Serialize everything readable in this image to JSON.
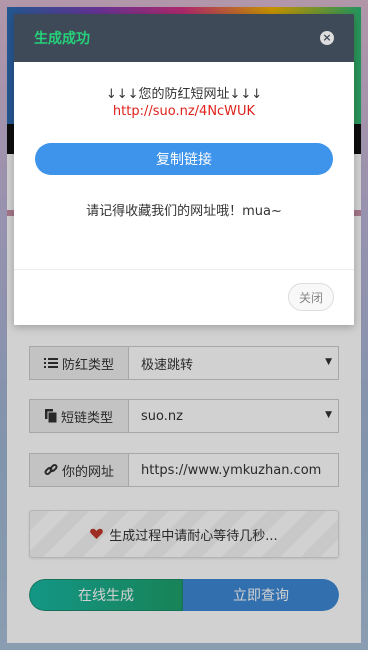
{
  "colors": {
    "dialog_header": "#3e4a57",
    "dialog_title": "#25d17b",
    "link": "#e0211b",
    "copy_button": "#3e93ea",
    "generate_button": "#18b8a4",
    "query_button": "#3d88d6"
  },
  "dialog": {
    "title": "生成成功",
    "close_icon": "close-icon",
    "line1": "↓↓↓您的防红短网址↓↓↓",
    "short_url": "http://suo.nz/4NcWUK",
    "copy_label": "复制链接",
    "note": "请记得收藏我们的网址哦！mua~",
    "close_button_label": "关闭"
  },
  "form": {
    "anti_red_type": {
      "label": "防红类型",
      "value": "极速跳转",
      "icon": "list-icon"
    },
    "short_type": {
      "label": "短链类型",
      "value": "suo.nz",
      "icon": "copy-icon"
    },
    "your_url": {
      "label": "你的网址",
      "value": "https://www.ymkuzhan.com",
      "icon": "link-icon"
    }
  },
  "status": {
    "text": "生成过程中请耐心等待几秒...",
    "icon": "heart-icon"
  },
  "actions": {
    "generate_label": "在线生成",
    "query_label": "立即查询"
  }
}
